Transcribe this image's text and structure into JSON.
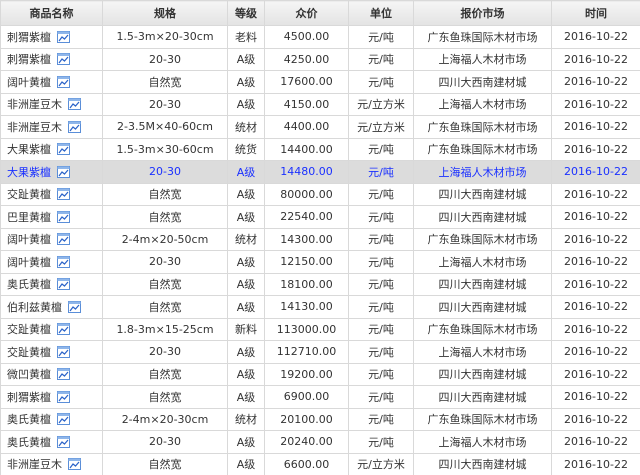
{
  "headers": [
    "商品名称",
    "规格",
    "等级",
    "众价",
    "单位",
    "报价市场",
    "时间"
  ],
  "icon_name": "chart-icon",
  "highlight_row": 6,
  "rows": [
    {
      "name": "刺猬紫檀",
      "spec": "1.5-3m×20-30cm",
      "grade": "老料",
      "price": "4500.00",
      "unit": "元/吨",
      "market": "广东鱼珠国际木材市场",
      "date": "2016-10-22"
    },
    {
      "name": "刺猬紫檀",
      "spec": "20-30",
      "grade": "A级",
      "price": "4250.00",
      "unit": "元/吨",
      "market": "上海福人木材市场",
      "date": "2016-10-22"
    },
    {
      "name": "阔叶黄檀",
      "spec": "自然宽",
      "grade": "A级",
      "price": "17600.00",
      "unit": "元/吨",
      "market": "四川大西南建材城",
      "date": "2016-10-22"
    },
    {
      "name": "非洲崖豆木",
      "spec": "20-30",
      "grade": "A级",
      "price": "4150.00",
      "unit": "元/立方米",
      "market": "上海福人木材市场",
      "date": "2016-10-22"
    },
    {
      "name": "非洲崖豆木",
      "spec": "2-3.5M×40-60cm",
      "grade": "统材",
      "price": "4400.00",
      "unit": "元/立方米",
      "market": "广东鱼珠国际木材市场",
      "date": "2016-10-22"
    },
    {
      "name": "大果紫檀",
      "spec": "1.5-3m×30-60cm",
      "grade": "统货",
      "price": "14400.00",
      "unit": "元/吨",
      "market": "广东鱼珠国际木材市场",
      "date": "2016-10-22"
    },
    {
      "name": "大果紫檀",
      "spec": "20-30",
      "grade": "A级",
      "price": "14480.00",
      "unit": "元/吨",
      "market": "上海福人木材市场",
      "date": "2016-10-22"
    },
    {
      "name": "交趾黄檀",
      "spec": "自然宽",
      "grade": "A级",
      "price": "80000.00",
      "unit": "元/吨",
      "market": "四川大西南建材城",
      "date": "2016-10-22"
    },
    {
      "name": "巴里黄檀",
      "spec": "自然宽",
      "grade": "A级",
      "price": "22540.00",
      "unit": "元/吨",
      "market": "四川大西南建材城",
      "date": "2016-10-22"
    },
    {
      "name": "阔叶黄檀",
      "spec": "2-4m×20-50cm",
      "grade": "统材",
      "price": "14300.00",
      "unit": "元/吨",
      "market": "广东鱼珠国际木材市场",
      "date": "2016-10-22"
    },
    {
      "name": "阔叶黄檀",
      "spec": "20-30",
      "grade": "A级",
      "price": "12150.00",
      "unit": "元/吨",
      "market": "上海福人木材市场",
      "date": "2016-10-22"
    },
    {
      "name": "奥氏黄檀",
      "spec": "自然宽",
      "grade": "A级",
      "price": "18100.00",
      "unit": "元/吨",
      "market": "四川大西南建材城",
      "date": "2016-10-22"
    },
    {
      "name": "伯利兹黄檀",
      "spec": "自然宽",
      "grade": "A级",
      "price": "14130.00",
      "unit": "元/吨",
      "market": "四川大西南建材城",
      "date": "2016-10-22"
    },
    {
      "name": "交趾黄檀",
      "spec": "1.8-3m×15-25cm",
      "grade": "新料",
      "price": "113000.00",
      "unit": "元/吨",
      "market": "广东鱼珠国际木材市场",
      "date": "2016-10-22"
    },
    {
      "name": "交趾黄檀",
      "spec": "20-30",
      "grade": "A级",
      "price": "112710.00",
      "unit": "元/吨",
      "market": "上海福人木材市场",
      "date": "2016-10-22"
    },
    {
      "name": "微凹黄檀",
      "spec": "自然宽",
      "grade": "A级",
      "price": "19200.00",
      "unit": "元/吨",
      "market": "四川大西南建材城",
      "date": "2016-10-22"
    },
    {
      "name": "刺猬紫檀",
      "spec": "自然宽",
      "grade": "A级",
      "price": "6900.00",
      "unit": "元/吨",
      "market": "四川大西南建材城",
      "date": "2016-10-22"
    },
    {
      "name": "奥氏黄檀",
      "spec": "2-4m×20-30cm",
      "grade": "统材",
      "price": "20100.00",
      "unit": "元/吨",
      "market": "广东鱼珠国际木材市场",
      "date": "2016-10-22"
    },
    {
      "name": "奥氏黄檀",
      "spec": "20-30",
      "grade": "A级",
      "price": "20240.00",
      "unit": "元/吨",
      "market": "上海福人木材市场",
      "date": "2016-10-22"
    },
    {
      "name": "非洲崖豆木",
      "spec": "自然宽",
      "grade": "A级",
      "price": "6600.00",
      "unit": "元/立方米",
      "market": "四川大西南建材城",
      "date": "2016-10-22"
    }
  ]
}
